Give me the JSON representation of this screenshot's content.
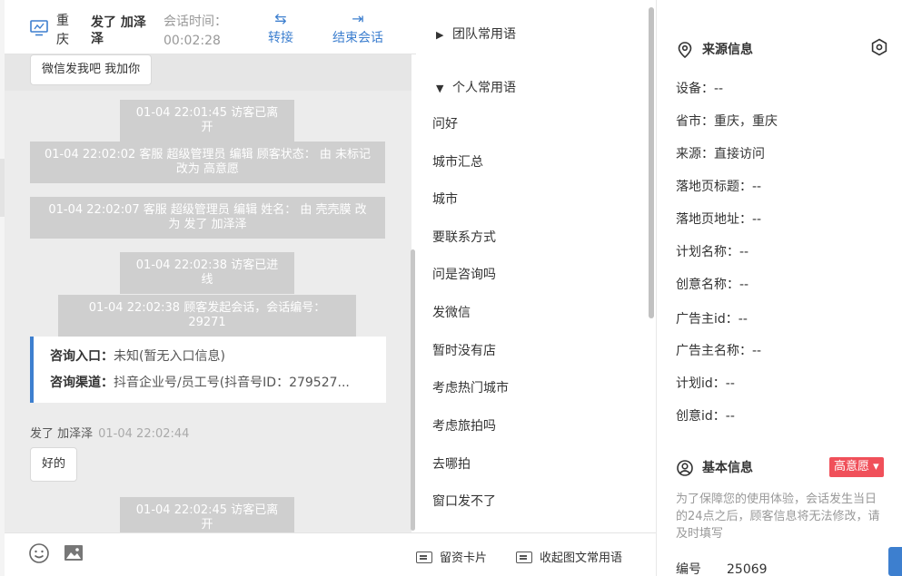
{
  "header": {
    "city": "重庆",
    "visitor_name": "发了 加泽泽",
    "session_time_label": "会话时间：",
    "session_time": "00:02:28",
    "transfer": "转接",
    "end_session": "结束会话"
  },
  "messages": {
    "top_bubble": "微信发我吧 我加你",
    "sys1": "01-04 22:01:45 访客已离开",
    "sys2": "01-04 22:02:02 客服 超级管理员 编辑 顾客状态： 由 未标记 改为 高意愿",
    "sys3": "01-04 22:02:07 客服 超级管理员 编辑 姓名： 由 壳壳膜 改为 发了 加泽泽",
    "sys4": "01-04 22:02:38 访客已进线",
    "sys5": "01-04 22:02:38 顾客发起会话，会话编号：29271",
    "card_entry_label": "咨询入口：",
    "card_entry_value": "未知(暂无入口信息)",
    "card_channel_label": "咨询渠道：",
    "card_channel_value": "抖音企业号/员工号(抖音号ID：279527...",
    "sender_name": "发了 加泽泽",
    "sender_time": "01-04 22:02:44",
    "reply_bubble": "好的",
    "sys6": "01-04 22:02:45 访客已离开"
  },
  "phrases": {
    "team_group": "团队常用语",
    "personal_group": "个人常用语",
    "items": [
      "问好",
      "城市汇总",
      "城市",
      "要联系方式",
      "问是咨询吗",
      "发微信",
      "暂时没有店",
      "考虑热门城市",
      "考虑旅拍吗",
      "去哪拍",
      "窗口发不了"
    ],
    "footer_card": "留资卡片",
    "footer_collapse": "收起图文常用语"
  },
  "source_info": {
    "title": "来源信息",
    "fields": [
      "设备：--",
      "省市：重庆，重庆",
      "来源：直接访问",
      "落地页标题：--",
      "落地页地址：--",
      "计划名称：--",
      "创意名称：--",
      "广告主id：--",
      "广告主名称：--",
      "计划id：--",
      "创意id：--"
    ]
  },
  "basic_info": {
    "title": "基本信息",
    "intent_badge": "高意愿",
    "note": "为了保障您的使用体验，会话发生当日的24点之后，顾客信息将无法修改，请及时填写",
    "number_label": "编号",
    "number_value": "25069"
  },
  "icons": {
    "header": "monitor-icon",
    "transfer": "transfer-arrows-icon",
    "end": "exit-icon",
    "emoji": "emoji-icon",
    "image": "image-icon",
    "location": "location-pin-icon",
    "settings": "hexagon-settings-icon",
    "user": "user-circle-icon"
  },
  "colors": {
    "accent": "#3d7fcf",
    "badge": "#f0505a",
    "system_message_bg": "#cfcfcf"
  }
}
